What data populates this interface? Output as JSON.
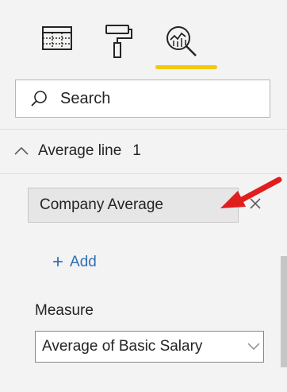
{
  "tabs": [
    {
      "name": "fields",
      "icon": "table-grid-icon"
    },
    {
      "name": "format",
      "icon": "paint-roller-icon"
    },
    {
      "name": "analytics",
      "icon": "analytics-magnifier-icon",
      "active": true
    }
  ],
  "search": {
    "placeholder": "Search"
  },
  "section": {
    "title": "Average line",
    "count": "1",
    "expanded": true
  },
  "average_line": {
    "label": "Company Average",
    "remove_icon": "close-icon",
    "annotation": "red-arrow-icon"
  },
  "add": {
    "plus": "+",
    "label": "Add"
  },
  "measure": {
    "label": "Measure",
    "value": "Average of Basic Salary"
  },
  "colors": {
    "accent_underline": "#f2c811",
    "add_link": "#2f6fb5",
    "arrow": "#e01e1e",
    "panel_bg": "#f3f3f3"
  }
}
